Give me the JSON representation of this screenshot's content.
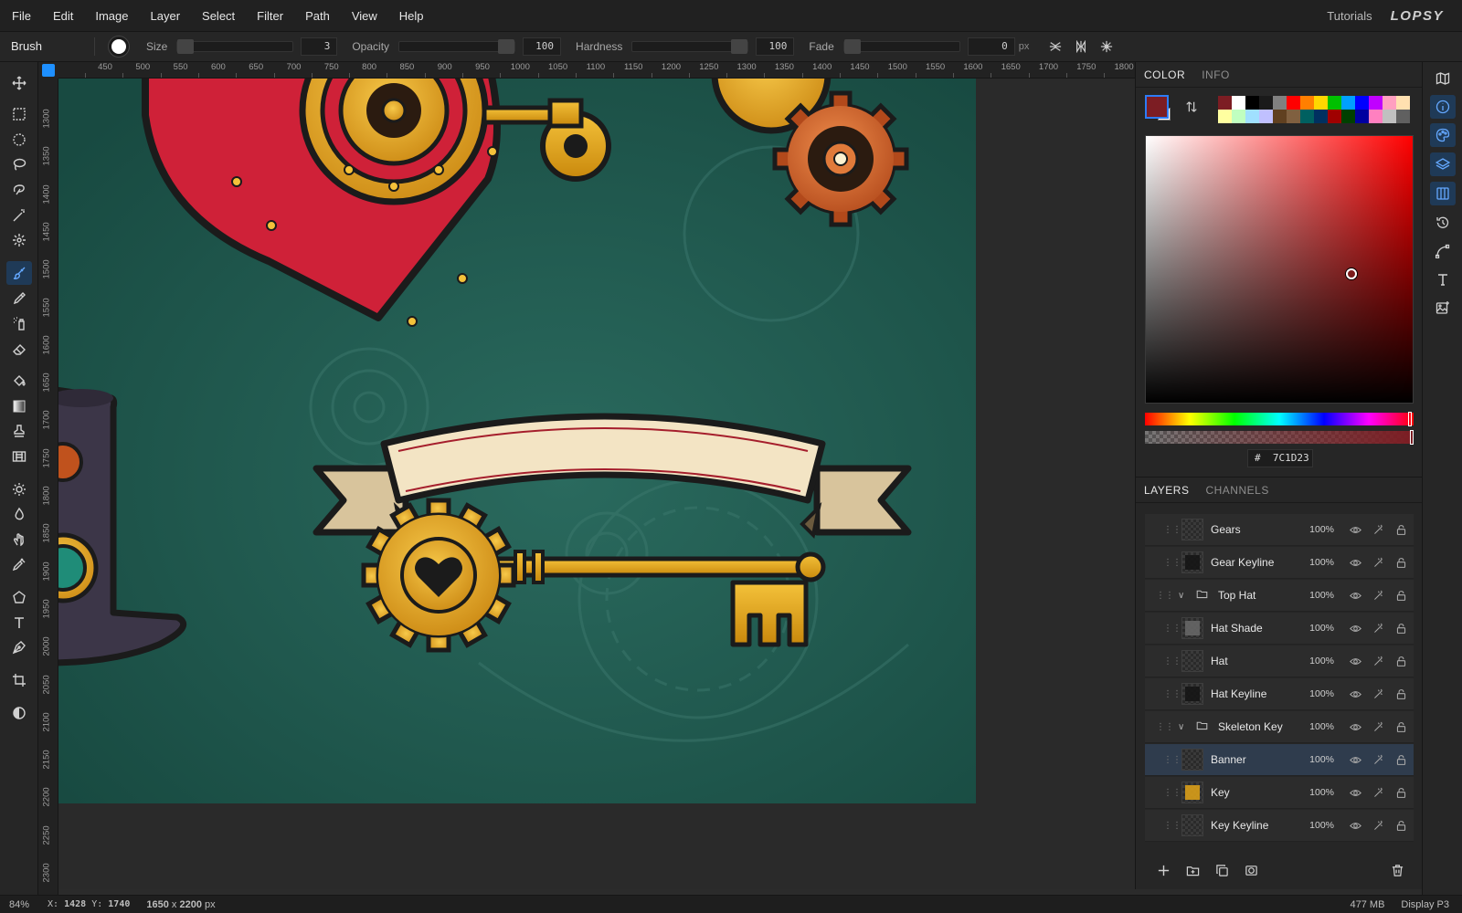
{
  "menu": [
    "File",
    "Edit",
    "Image",
    "Layer",
    "Select",
    "Filter",
    "Path",
    "View",
    "Help"
  ],
  "header": {
    "tutorials": "Tutorials",
    "logo": "LOPSY"
  },
  "tool_options": {
    "tool_name": "Brush",
    "size_label": "Size",
    "size_value": "3",
    "opacity_label": "Opacity",
    "opacity_value": "100",
    "hardness_label": "Hardness",
    "hardness_value": "100",
    "fade_label": "Fade",
    "fade_value": "0",
    "fade_unit": "px"
  },
  "ruler": {
    "h_ticks": [
      "450",
      "500",
      "550",
      "600",
      "650",
      "700",
      "750",
      "800",
      "850",
      "900",
      "950",
      "1000",
      "1050",
      "1100",
      "1150",
      "1200",
      "1250",
      "1300",
      "1350",
      "1400",
      "1450",
      "1500",
      "1550",
      "1600",
      "1650",
      "1700",
      "1750",
      "1800"
    ],
    "v_ticks": [
      "1300",
      "1350",
      "1400",
      "1450",
      "1500",
      "1550",
      "1600",
      "1650",
      "1700",
      "1750",
      "1800",
      "1850",
      "1900",
      "1950",
      "2000",
      "2050",
      "2100",
      "2150",
      "2200",
      "2250",
      "2300"
    ]
  },
  "color_panel": {
    "tabs": [
      "COLOR",
      "INFO"
    ],
    "active_tab": "COLOR",
    "foreground": "#7C1D23",
    "background": "#FFFFFF",
    "hue_color": "#FF0000",
    "hex_prefix": "#",
    "hex_value": "7C1D23",
    "palette": [
      "#7c1d23",
      "#ffffff",
      "#000000",
      "#1a1a1a",
      "#808080",
      "#ff0000",
      "#ff7f00",
      "#ffd700",
      "#00c000",
      "#00a0ff",
      "#0000ff",
      "#c000ff",
      "#ff9fc0",
      "#ffe0b0",
      "#ffffa0",
      "#c0ffc0",
      "#a0e0ff",
      "#c0c0ff",
      "#604020",
      "#806040",
      "#006060",
      "#003060",
      "#a00000",
      "#004000",
      "#0000a0",
      "#ff80c0",
      "#c0c0c0",
      "#606060"
    ]
  },
  "layers_panel": {
    "tabs": [
      "LAYERS",
      "CHANNELS"
    ],
    "active_tab": "LAYERS",
    "layers": [
      {
        "name": "Gears",
        "opacity": "100%",
        "type": "layer",
        "indent": 1,
        "thumb": "empty"
      },
      {
        "name": "Gear Keyline",
        "opacity": "100%",
        "type": "layer",
        "indent": 1,
        "thumb": "dark"
      },
      {
        "name": "Top Hat",
        "opacity": "100%",
        "type": "group",
        "indent": 0,
        "thumb": "folder"
      },
      {
        "name": "Hat Shade",
        "opacity": "100%",
        "type": "layer",
        "indent": 1,
        "thumb": "shade"
      },
      {
        "name": "Hat",
        "opacity": "100%",
        "type": "layer",
        "indent": 1,
        "thumb": "empty"
      },
      {
        "name": "Hat Keyline",
        "opacity": "100%",
        "type": "layer",
        "indent": 1,
        "thumb": "dark"
      },
      {
        "name": "Skeleton Key",
        "opacity": "100%",
        "type": "group",
        "indent": 0,
        "thumb": "folder"
      },
      {
        "name": "Banner",
        "opacity": "100%",
        "type": "layer",
        "indent": 1,
        "thumb": "empty",
        "selected": true
      },
      {
        "name": "Key",
        "opacity": "100%",
        "type": "layer",
        "indent": 1,
        "thumb": "key"
      },
      {
        "name": "Key Keyline",
        "opacity": "100%",
        "type": "layer",
        "indent": 1,
        "thumb": "empty"
      }
    ]
  },
  "status": {
    "zoom": "84%",
    "x_label": "X:",
    "x": "1428",
    "y_label": "Y:",
    "y": "1740",
    "doc_w": "1650",
    "doc_x": "x",
    "doc_h": "2200",
    "doc_unit": "px",
    "memory": "477 MB",
    "profile": "Display P3"
  },
  "colors": {
    "canvas_bg": "#1f5349",
    "accent": "#2d7cf6",
    "gold": "#e3a417",
    "heart_red": "#cf2138",
    "banner_cream": "#f3e4c4"
  }
}
